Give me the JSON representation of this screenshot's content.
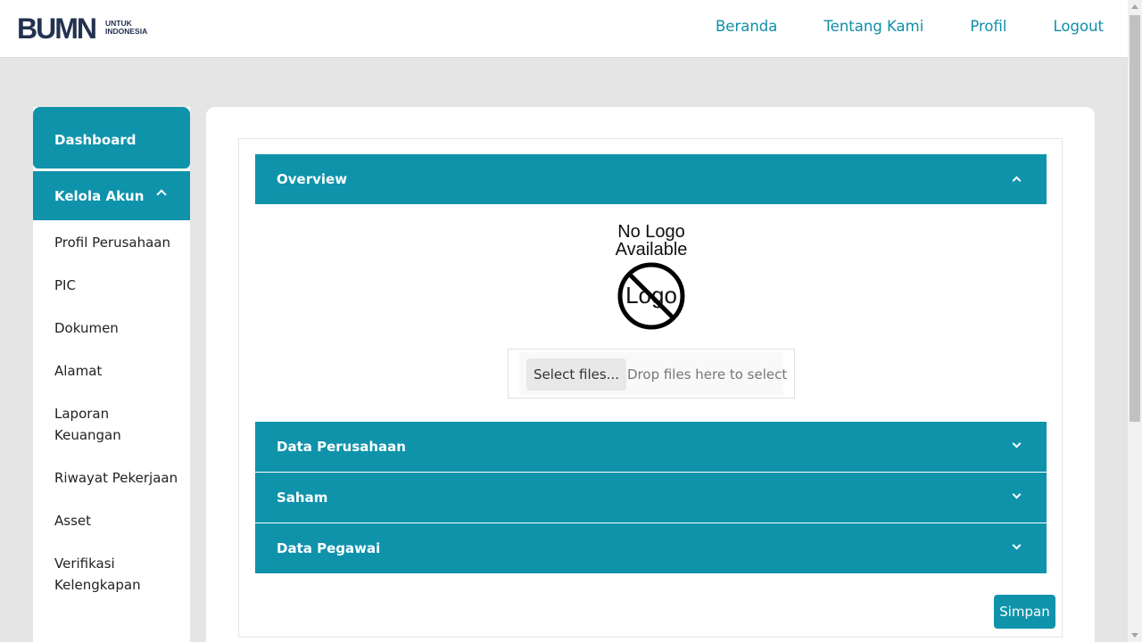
{
  "brand": {
    "mark": "BUMN",
    "tagline_line1": "UNTUK",
    "tagline_line2": "INDONESIA"
  },
  "nav": [
    "Beranda",
    "Tentang Kami",
    "Profil",
    "Logout"
  ],
  "sidebar": {
    "dashboard": "Dashboard",
    "kelola_akun": "Kelola Akun",
    "items": [
      "Profil Perusahaan",
      "PIC",
      "Dokumen",
      "Alamat",
      "Laporan Keuangan",
      "Riwayat Pekerjaan",
      "Asset",
      "Verifikasi Kelengkapan"
    ]
  },
  "sections": {
    "overview": "Overview",
    "data_perusahaan": "Data Perusahaan",
    "saham": "Saham",
    "data_pegawai": "Data Pegawai"
  },
  "logo_placeholder": {
    "line1": "No Logo",
    "line2": "Available",
    "badge": "Logo"
  },
  "upload": {
    "button": "Select files...",
    "hint": "Drop files here to select"
  },
  "save_button": "Simpan",
  "colors": {
    "primary": "#0f93ab",
    "nav_text": "#0f8fa8",
    "background": "#e5e5e5"
  }
}
